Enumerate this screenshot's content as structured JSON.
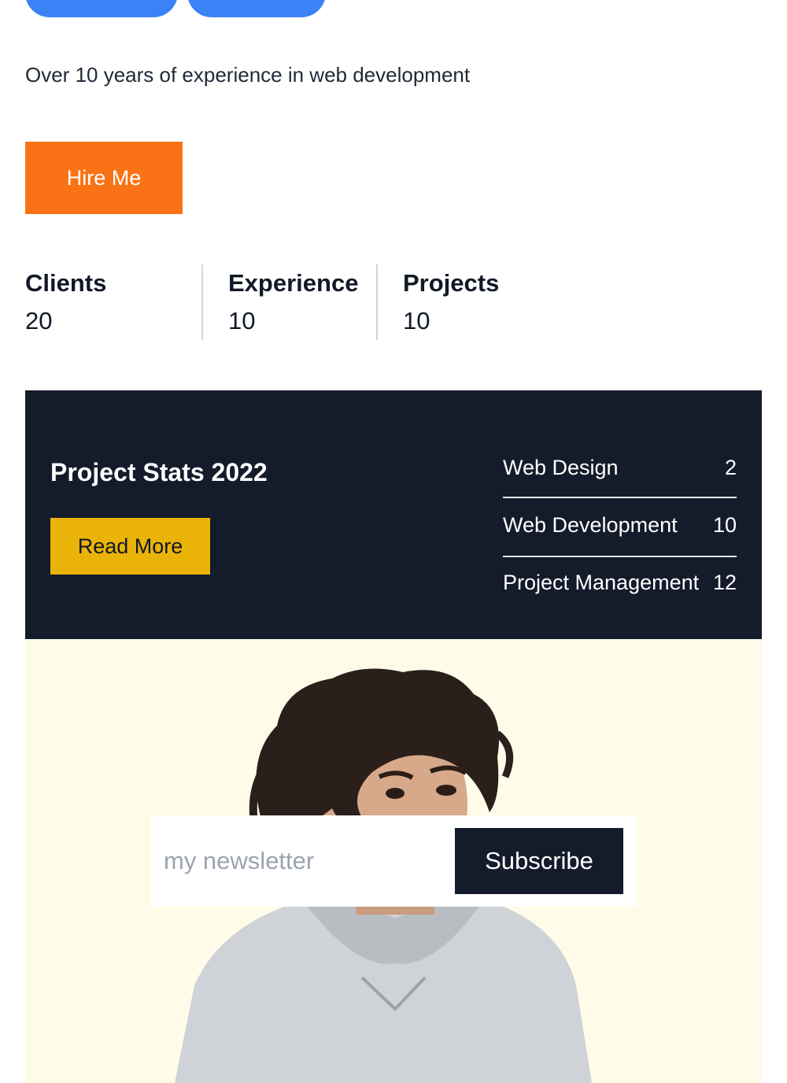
{
  "intro": {
    "text": "Over 10 years of experience in web development"
  },
  "hire_button": {
    "label": "Hire Me"
  },
  "stats": [
    {
      "label": "Clients",
      "value": "20"
    },
    {
      "label": "Experience",
      "value": "10"
    },
    {
      "label": "Projects",
      "value": "10"
    }
  ],
  "project_stats": {
    "title": "Project Stats 2022",
    "read_more_label": "Read More",
    "items": [
      {
        "name": "Web Design",
        "count": "2"
      },
      {
        "name": "Web Development",
        "count": "10"
      },
      {
        "name": "Project Management",
        "count": "12"
      }
    ]
  },
  "newsletter": {
    "placeholder": "my newsletter",
    "subscribe_label": "Subscribe"
  },
  "colors": {
    "pill": "#3b82f6",
    "hire": "#f97316",
    "dark": "#141b2b",
    "read_more": "#eab308",
    "hero_bg": "#fefce8"
  }
}
